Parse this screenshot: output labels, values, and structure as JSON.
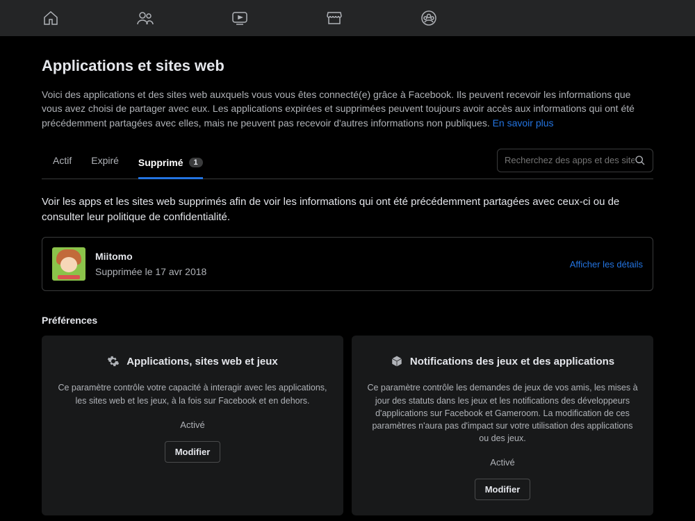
{
  "page": {
    "title": "Applications et sites web",
    "intro": "Voici des applications et des sites web auxquels vous vous êtes connecté(e) grâce à Facebook. Ils peuvent recevoir les informations que vous avez choisi de partager avec eux. Les applications expirées et supprimées peuvent toujours avoir accès aux informations qui ont été précédemment partagées avec elles, mais ne peuvent pas recevoir d'autres informations non publiques. ",
    "learn_more": "En savoir plus"
  },
  "tabs": {
    "active": "Actif",
    "expired": "Expiré",
    "removed": "Supprimé",
    "removed_count": "1"
  },
  "search": {
    "placeholder": "Recherchez des apps et des sites web"
  },
  "removed_desc": "Voir les apps et les sites web supprimés afin de voir les informations qui ont été précédemment partagées avec ceux-ci ou de consulter leur politique de confidentialité.",
  "app": {
    "name": "Miitomo",
    "status": "Supprimée le 17 avr 2018",
    "details": "Afficher les détails"
  },
  "prefs": {
    "section": "Préférences",
    "card1": {
      "title": "Applications, sites web et jeux",
      "desc": "Ce paramètre contrôle votre capacité à interagir avec les applications, les sites web et les jeux, à la fois sur Facebook et en dehors.",
      "state": "Activé",
      "button": "Modifier"
    },
    "card2": {
      "title": "Notifications des jeux et des applications",
      "desc": "Ce paramètre contrôle les demandes de jeux de vos amis, les mises à jour des statuts dans les jeux et les notifications des développeurs d'applications sur Facebook et Gameroom. La modification de ces paramètres n'aura pas d'impact sur votre utilisation des applications ou des jeux.",
      "state": "Activé",
      "button": "Modifier"
    }
  }
}
